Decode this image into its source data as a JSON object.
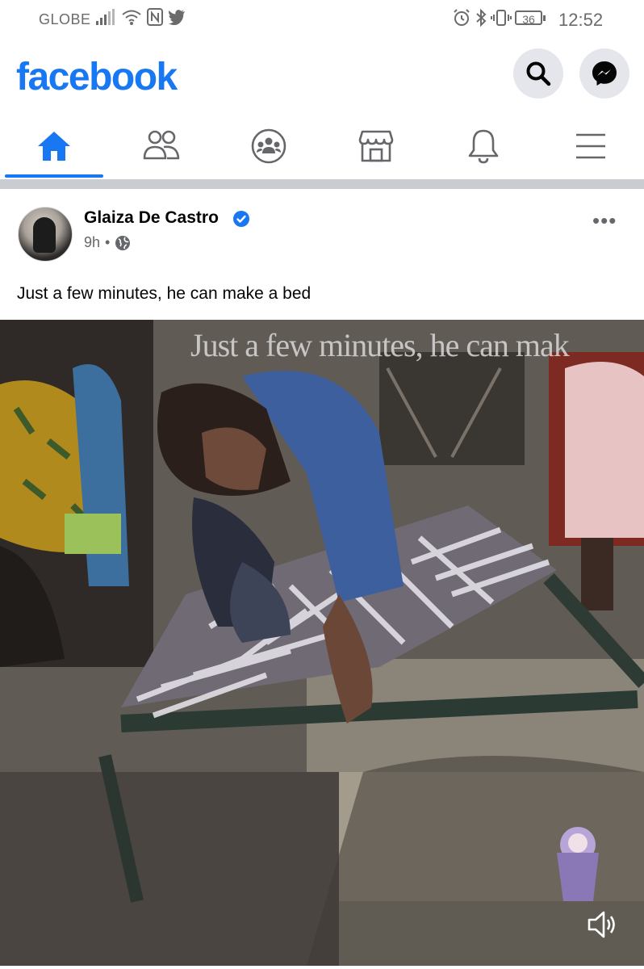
{
  "status_bar": {
    "carrier": "GLOBE",
    "battery": "36",
    "time": "12:52"
  },
  "header": {
    "logo": "facebook",
    "icons": [
      "search-icon",
      "messenger-icon"
    ]
  },
  "nav": {
    "tabs": [
      "home-icon",
      "friends-icon",
      "groups-icon",
      "marketplace-icon",
      "notifications-icon",
      "menu-icon"
    ],
    "active_tab": "home-icon"
  },
  "post": {
    "author": "Glaiza De Castro",
    "time": "9h",
    "separator": "•",
    "text": "Just a few minutes, he can make a bed",
    "more": "•••",
    "video_caption": "Just a few minutes, he can mak"
  },
  "colors": {
    "brand": "#1877f2",
    "secondary_text": "#65676b",
    "icon_bg": "#e4e6eb"
  }
}
